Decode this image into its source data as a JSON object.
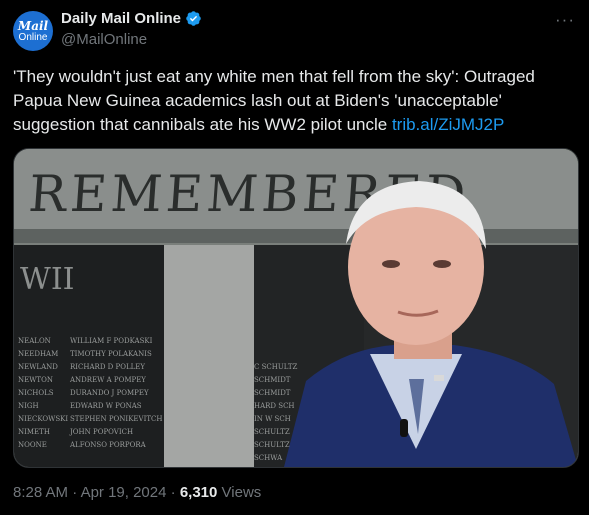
{
  "author": {
    "avatar_line1": "Mail",
    "avatar_line2": "Online",
    "display_name": "Daily Mail Online",
    "handle": "@MailOnline",
    "verified": true,
    "brand_color": "#1d6fd2"
  },
  "tweet": {
    "text": "'They wouldn't just eat any white men that fell from the sky': Outraged Papua New Guinea academics lash out at Biden's 'unacceptable' suggestion that cannibals ate his WW2 pilot uncle ",
    "link": "trib.al/ZiJMJ2P"
  },
  "media": {
    "memorial_heading": "REMEMBERED",
    "panel_heading": "WII",
    "names_col1": [
      "NEALON",
      "NEEDHAM",
      "NEWLAND",
      "NEWTON",
      "NICHOLS",
      "NIGH",
      "NIECKOWSKI",
      "NIMETH",
      "NOONE"
    ],
    "names_col2": [
      "WILLIAM F PODKASKI",
      "TIMOTHY POLAKANIS",
      "RICHARD D POLLEY",
      "ANDREW A POMPEY",
      "DURANDO J POMPEY",
      "EDWARD W PONAS",
      "STEPHEN PONIKEVITCH",
      "JOHN POPOVICH",
      "ALFONSO PORPORA"
    ],
    "names_col3": [
      "C SCHULTZ",
      "SCHMIDT",
      "SCHMIDT",
      "HARD SCH",
      "IN W SCH",
      "SCHULTZ",
      "SCHULTZ",
      "SCHWA"
    ]
  },
  "footer": {
    "time": "8:28 AM",
    "separator": " · ",
    "date": "Apr 19, 2024",
    "views_count": "6,310",
    "views_label": "Views"
  },
  "icons": {
    "more": "more-icon",
    "verified": "verified-badge-icon"
  }
}
